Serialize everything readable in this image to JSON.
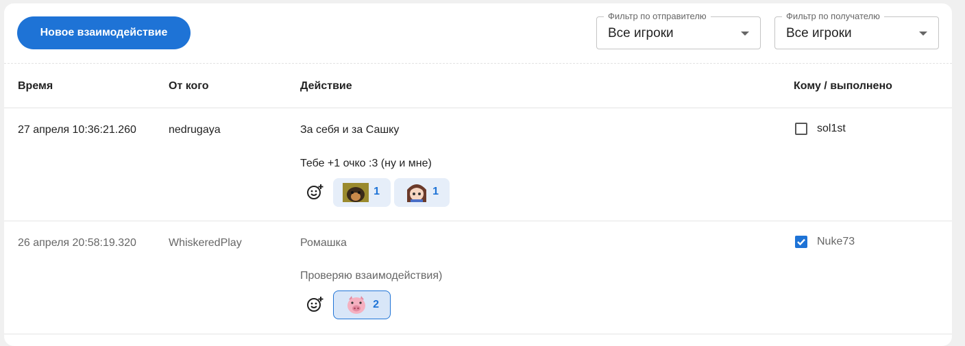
{
  "toolbar": {
    "new_button_label": "Новое взаимодействие",
    "sender_filter": {
      "label": "Фильтр по отправителю",
      "value": "Все игроки"
    },
    "recipient_filter": {
      "label": "Фильтр по получателю",
      "value": "Все игроки"
    }
  },
  "table": {
    "headers": {
      "time": "Время",
      "from": "От кого",
      "action": "Действие",
      "to": "Кому / выполнено"
    },
    "rows": [
      {
        "time": "27 апреля 10:36:21.260",
        "from": "nedrugaya",
        "action_title": "За себя и за Сашку",
        "action_desc": "Тебе +1 очко :3 (ну и мне)",
        "reactions": [
          {
            "icon": "dog-photo-icon",
            "count": "1"
          },
          {
            "icon": "anime-girl-icon",
            "count": "1"
          }
        ],
        "to": "sol1st",
        "done": false
      },
      {
        "time": "26 апреля 20:58:19.320",
        "from": "WhiskeredPlay",
        "action_title": "Ромашка",
        "action_desc": "Проверяю взаимодействия)",
        "reactions": [
          {
            "icon": "pig-icon",
            "count": "2",
            "selected": true
          }
        ],
        "to": "Nuke73",
        "done": true
      }
    ]
  },
  "colors": {
    "accent": "#1e73d6",
    "chip_bg": "#e6eef9"
  }
}
